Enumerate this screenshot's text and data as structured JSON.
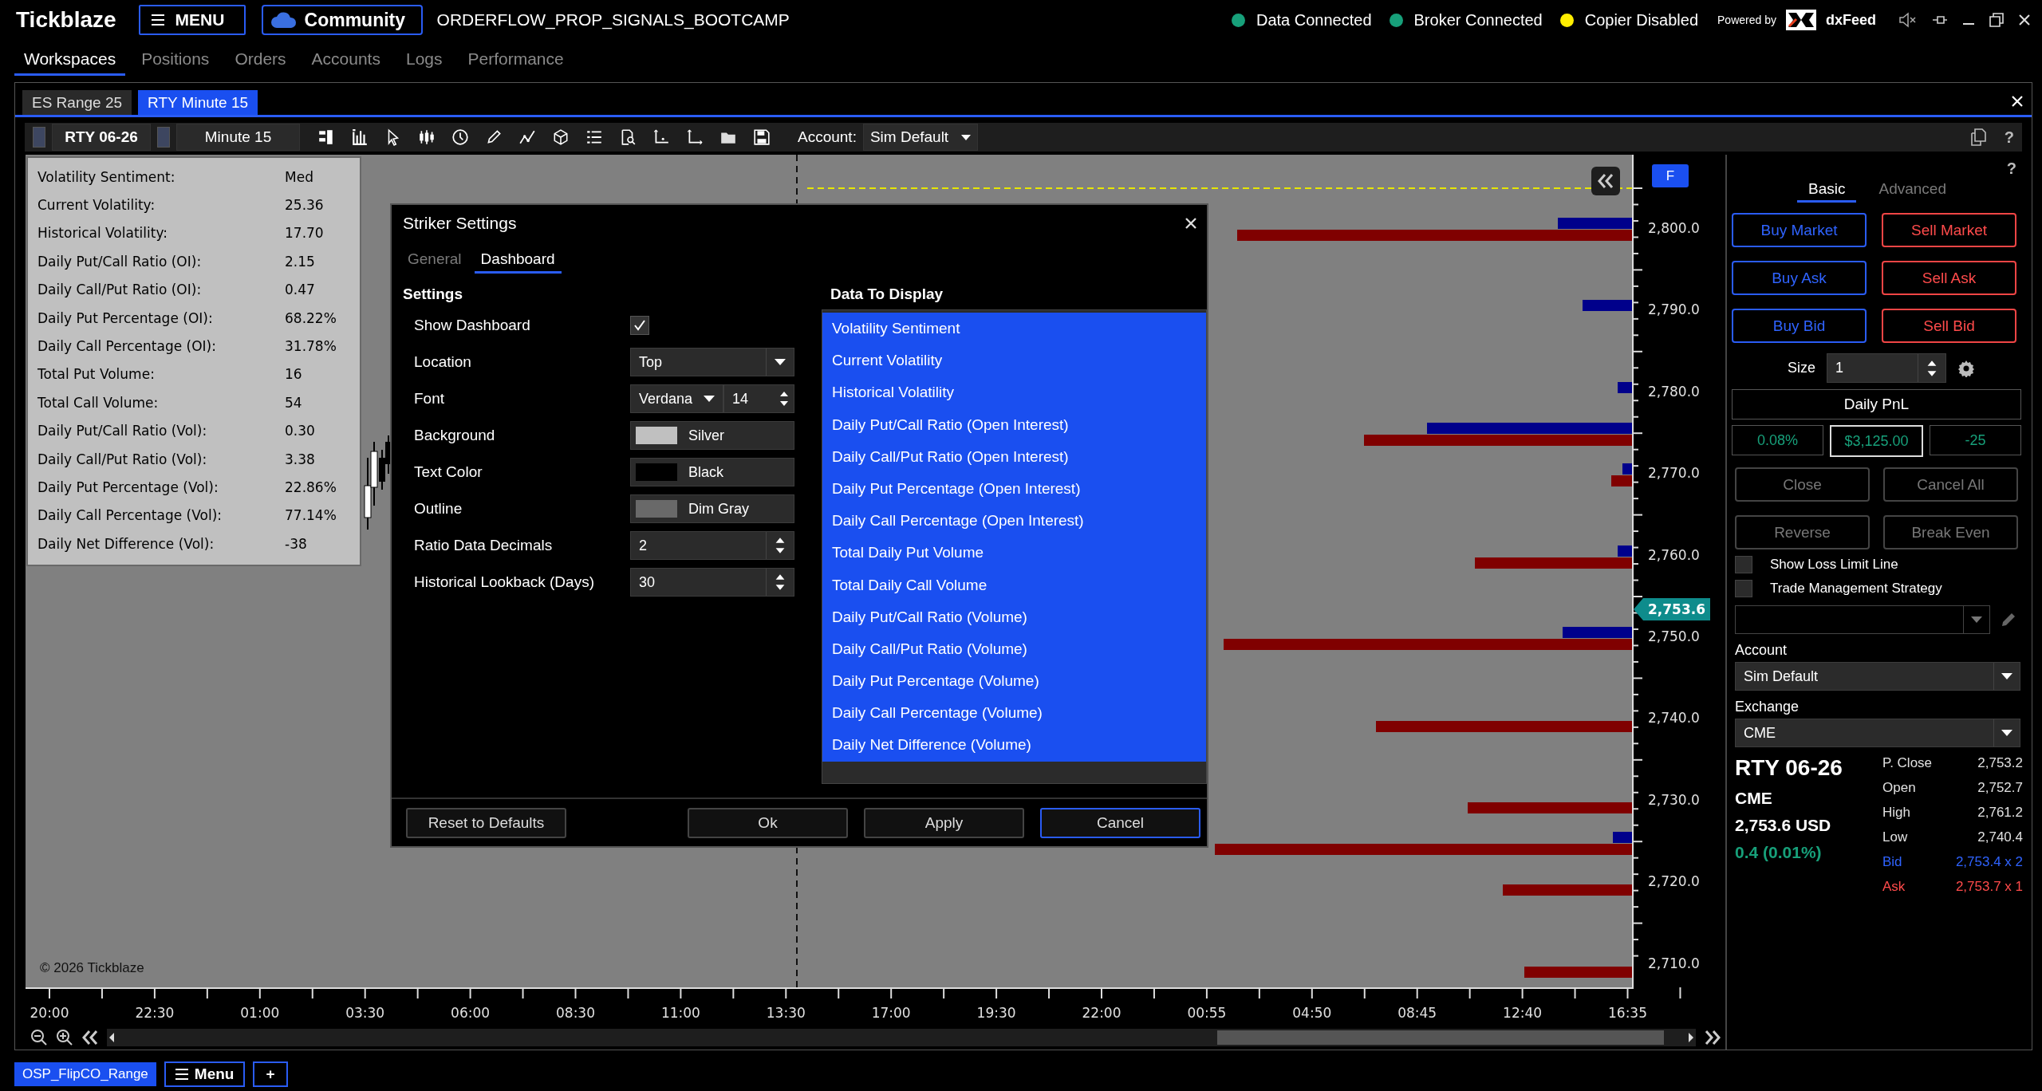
{
  "app": {
    "logo": "Tickblaze",
    "menu_button": "MENU",
    "community_button": "Community",
    "workspace_title": "ORDERFLOW_PROP_SIGNALS_BOOTCAMP"
  },
  "status": [
    {
      "label": "Data Connected",
      "color": "#17a07a"
    },
    {
      "label": "Broker Connected",
      "color": "#17a07a"
    },
    {
      "label": "Copier Disabled",
      "color": "#ffee00"
    }
  ],
  "powered_by": {
    "text": "Powered by",
    "brand": "dxFeed"
  },
  "nav_tabs": [
    {
      "label": "Workspaces",
      "selected": true
    },
    {
      "label": "Positions",
      "selected": false
    },
    {
      "label": "Orders",
      "selected": false
    },
    {
      "label": "Accounts",
      "selected": false
    },
    {
      "label": "Logs",
      "selected": false
    },
    {
      "label": "Performance",
      "selected": false
    }
  ],
  "workspace_tabs": [
    {
      "label": "ES Range 25",
      "selected": false
    },
    {
      "label": "RTY Minute 15",
      "selected": true
    }
  ],
  "chart_toolbar": {
    "symbol": "RTY 06-26",
    "interval": "Minute 15",
    "account_label": "Account:",
    "account": "Sim Default",
    "help": "?"
  },
  "dashboard": [
    {
      "label": "Volatility Sentiment:",
      "value": "Med"
    },
    {
      "label": "Current Volatility:",
      "value": "25.36"
    },
    {
      "label": "Historical Volatility:",
      "value": "17.70"
    },
    {
      "label": "Daily Put/Call Ratio (OI):",
      "value": "2.15"
    },
    {
      "label": "Daily Call/Put Ratio (OI):",
      "value": "0.47"
    },
    {
      "label": "Daily Put Percentage (OI):",
      "value": "68.22%"
    },
    {
      "label": "Daily Call Percentage (OI):",
      "value": "31.78%"
    },
    {
      "label": "Total Put Volume:",
      "value": "16"
    },
    {
      "label": "Total Call Volume:",
      "value": "54"
    },
    {
      "label": "Daily Put/Call Ratio (Vol):",
      "value": "0.30"
    },
    {
      "label": "Daily Call/Put Ratio (Vol):",
      "value": "3.38"
    },
    {
      "label": "Daily Put Percentage (Vol):",
      "value": "22.86%"
    },
    {
      "label": "Daily Call Percentage (Vol):",
      "value": "77.14%"
    },
    {
      "label": "Daily Net Difference (Vol):",
      "value": "-38"
    }
  ],
  "chart": {
    "f_button": "F",
    "current_price": "2,753.6",
    "copyright": "© 2026 Tickblaze",
    "price_ticks": [
      "2,800.0",
      "2,790.0",
      "2,780.0",
      "2,770.0",
      "2,760.0",
      "2,750.0",
      "2,740.0",
      "2,730.0",
      "2,720.0",
      "2,710.0"
    ],
    "time_labels": [
      "20:00",
      "22:30",
      "01:00",
      "03:30",
      "06:00",
      "08:30",
      "11:00",
      "13:30",
      "17:00",
      "19:30",
      "22:00",
      "00:55",
      "04:50",
      "08:45",
      "12:40",
      "16:35"
    ]
  },
  "dialog": {
    "title": "Striker Settings",
    "tabs": [
      {
        "label": "General",
        "selected": false
      },
      {
        "label": "Dashboard",
        "selected": true
      }
    ],
    "settings_heading": "Settings",
    "settings": [
      {
        "label": "Show Dashboard",
        "kind": "checkbox",
        "checked": true
      },
      {
        "label": "Location",
        "kind": "select",
        "value": "Top"
      },
      {
        "label": "Font",
        "kind": "font",
        "value": "Verdana",
        "size": "14"
      },
      {
        "label": "Background",
        "kind": "color",
        "value": "Silver",
        "color": "#c0c0c0"
      },
      {
        "label": "Text Color",
        "kind": "color",
        "value": "Black",
        "color": "#000000"
      },
      {
        "label": "Outline",
        "kind": "color",
        "value": "Dim Gray",
        "color": "#696969"
      },
      {
        "label": "Ratio Data Decimals",
        "kind": "spinner",
        "value": "2"
      },
      {
        "label": "Historical Lookback (Days)",
        "kind": "spinner",
        "value": "30"
      }
    ],
    "list_heading": "Data To Display",
    "list_items": [
      {
        "label": "Volatility Sentiment",
        "selected": true
      },
      {
        "label": "Current Volatility",
        "selected": true
      },
      {
        "label": "Historical Volatility",
        "selected": true
      },
      {
        "label": "Daily Put/Call Ratio (Open Interest)",
        "selected": true
      },
      {
        "label": "Daily Call/Put Ratio (Open Interest)",
        "selected": true
      },
      {
        "label": "Daily Put Percentage (Open Interest)",
        "selected": true
      },
      {
        "label": "Daily Call Percentage (Open Interest)",
        "selected": true
      },
      {
        "label": "Total Daily Put Volume",
        "selected": true
      },
      {
        "label": "Total Daily Call Volume",
        "selected": true
      },
      {
        "label": "Daily Put/Call Ratio (Volume)",
        "selected": true
      },
      {
        "label": "Daily Call/Put Ratio (Volume)",
        "selected": true
      },
      {
        "label": "Daily Put Percentage (Volume)",
        "selected": true
      },
      {
        "label": "Daily Call Percentage (Volume)",
        "selected": true
      },
      {
        "label": "Daily Net Difference (Volume)",
        "selected": true
      }
    ],
    "buttons": [
      {
        "label": "Reset to Defaults",
        "focused": false
      },
      {
        "label": "Ok",
        "focused": false
      },
      {
        "label": "Apply",
        "focused": false
      },
      {
        "label": "Cancel",
        "focused": true
      }
    ]
  },
  "order_panel": {
    "help": "?",
    "tabs": [
      {
        "label": "Basic",
        "selected": true
      },
      {
        "label": "Advanced",
        "selected": false
      }
    ],
    "order_buttons": [
      {
        "label": "Buy Market",
        "kind": "buy"
      },
      {
        "label": "Sell Market",
        "kind": "sell"
      },
      {
        "label": "Buy Ask",
        "kind": "buy"
      },
      {
        "label": "Sell Ask",
        "kind": "sell"
      },
      {
        "label": "Buy Bid",
        "kind": "buy"
      },
      {
        "label": "Sell Bid",
        "kind": "sell"
      }
    ],
    "size_label": "Size",
    "size": "1",
    "pnl_title": "Daily PnL",
    "pnl": [
      {
        "value": "0.08%",
        "selected": false
      },
      {
        "value": "$3,125.00",
        "selected": true
      },
      {
        "value": "-25",
        "selected": false
      }
    ],
    "actions": [
      {
        "label": "Close",
        "disabled": true
      },
      {
        "label": "Cancel All",
        "disabled": true
      },
      {
        "label": "Reverse",
        "disabled": true
      },
      {
        "label": "Break Even",
        "disabled": true
      }
    ],
    "checkboxes": [
      {
        "label": "Show Loss Limit Line",
        "checked": false
      },
      {
        "label": "Trade Management Strategy",
        "checked": false
      }
    ],
    "account_label": "Account",
    "account": "Sim Default",
    "exchange_label": "Exchange",
    "exchange": "CME",
    "quote": {
      "symbol": "RTY 06-26",
      "exchange": "CME",
      "price": "2,753.6 USD",
      "change": "0.4 (0.01%)",
      "stats": [
        {
          "label": "P. Close",
          "value": "2,753.2",
          "kind": "plain"
        },
        {
          "label": "Open",
          "value": "2,752.7",
          "kind": "plain"
        },
        {
          "label": "High",
          "value": "2,761.2",
          "kind": "plain"
        },
        {
          "label": "Low",
          "value": "2,740.4",
          "kind": "plain"
        },
        {
          "label": "Bid",
          "value": "2,753.4 x 2",
          "kind": "bid"
        },
        {
          "label": "Ask",
          "value": "2,753.7 x 1",
          "kind": "ask"
        }
      ]
    }
  },
  "bottom_bar": {
    "workspace_tab": "OSP_FlipCO_Range",
    "menu_button": "Menu",
    "add_button": "+"
  }
}
